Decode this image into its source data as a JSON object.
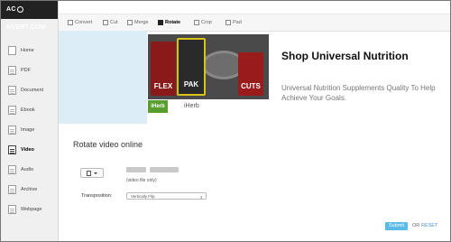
{
  "logo": {
    "part1": "AC",
    "part2": "NVERT.COM"
  },
  "sidebar": {
    "items": [
      {
        "label": "Home",
        "icon": "home-icon"
      },
      {
        "label": "PDF",
        "icon": "pdf-icon"
      },
      {
        "label": "Document",
        "icon": "document-icon"
      },
      {
        "label": "Ebook",
        "icon": "ebook-icon"
      },
      {
        "label": "Image",
        "icon": "image-icon"
      },
      {
        "label": "Video",
        "icon": "video-icon",
        "active": true
      },
      {
        "label": "Audio",
        "icon": "audio-icon"
      },
      {
        "label": "Archive",
        "icon": "archive-icon"
      },
      {
        "label": "Webpage",
        "icon": "webpage-icon"
      }
    ]
  },
  "tabs": [
    {
      "label": "Convert"
    },
    {
      "label": "Cut"
    },
    {
      "label": "Merge"
    },
    {
      "label": "Rotate",
      "active": true
    },
    {
      "label": "Crop"
    },
    {
      "label": "Pad"
    }
  ],
  "ad": {
    "products": [
      "FLEX",
      "PAK",
      "CUTS"
    ],
    "brand_logo": "iHerb",
    "brand_name": "iHerb",
    "title": "Shop Universal Nutrition",
    "description": "Universal Nutrition Supplements Quality To Help Achieve Your Goals."
  },
  "form": {
    "title": "Rotate video online",
    "file_hint": "(video file only)",
    "transposition_label": "Transposition:",
    "transposition_value": "Vertically Flip",
    "submit_label": "Submit",
    "or_label": "OR",
    "reset_label": "RESET"
  },
  "colors": {
    "accent": "#5bbbe6",
    "brand_green": "#5a9e2f",
    "ad_panel": "#dcedf8"
  }
}
